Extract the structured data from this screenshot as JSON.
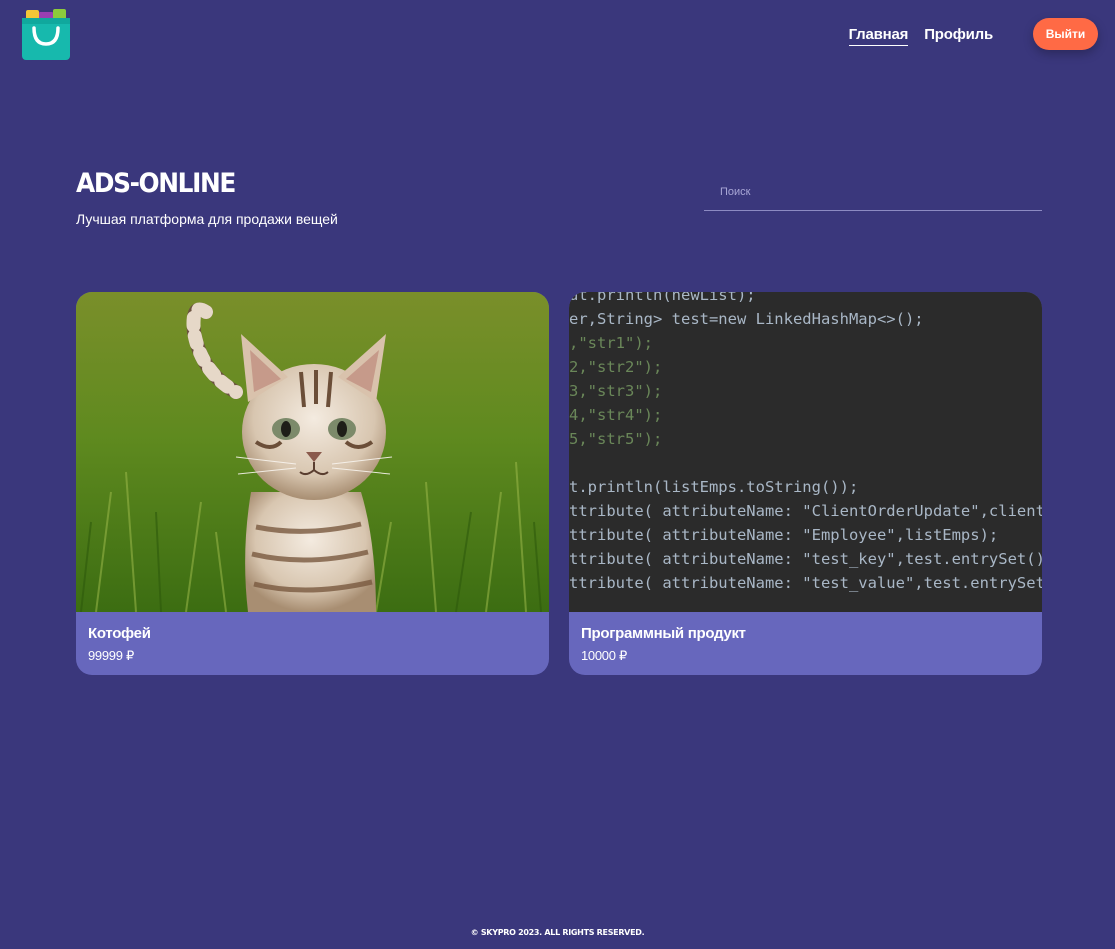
{
  "header": {
    "nav": [
      {
        "label": "Главная",
        "active": true
      },
      {
        "label": "Профиль",
        "active": false
      }
    ],
    "logout_label": "Выйти"
  },
  "hero": {
    "brand": "ADS-ONLINE",
    "tagline": "Лучшая платформа для продажи вещей",
    "search_placeholder": "Поиск"
  },
  "ads": [
    {
      "title": "Котофей",
      "price": "99999 ₽",
      "image": "kitten-photo"
    },
    {
      "title": "Программный продукт",
      "price": "10000 ₽",
      "image": "code-screenshot"
    }
  ],
  "code_image": {
    "lines": [
      "ut.println(newList);",
      "er,String> test=new LinkedHashMap<>();",
      ",\"str1\");",
      "2,\"str2\");",
      "3,\"str3\");",
      "4,\"str4\");",
      "5,\"str5\");",
      "",
      "t.println(listEmps.toString());",
      "ttribute( attributeName: \"ClientOrderUpdate\",clientRequest",
      "ttribute( attributeName: \"Employee\",listEmps);",
      "ttribute( attributeName: \"test_key\",test.entrySet().iterat",
      "ttribute( attributeName: \"test_value\",test.entrySet().iter"
    ]
  },
  "footer": "© SKYPRO 2023. ALL RIGHTS RESERVED.",
  "colors": {
    "background": "#3a377c",
    "card_footer": "#6767bd",
    "accent": "#ff6a45",
    "logo": "#1ec4b5"
  }
}
